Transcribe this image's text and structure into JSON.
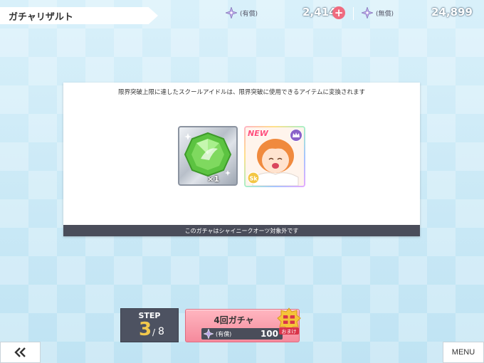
{
  "header": {
    "title": "ガチャリザルト",
    "paid_stars": {
      "label": "(有償)",
      "value": "2,414",
      "icon": "star-gem-icon"
    },
    "plus_label": "+",
    "free_stars": {
      "label": "(無償)",
      "value": "24,899",
      "icon": "star-gem-icon"
    }
  },
  "panel": {
    "message": "限界突破上限に達したスクールアイドルは、限界突破に使用できるアイテムに変換されます",
    "items": [
      {
        "type": "limit-break-gem",
        "quantity": "×1",
        "color": "#5cc341"
      },
      {
        "type": "idol-card",
        "badge": "NEW",
        "rarity_icon": "crown-icon",
        "attribute": "Sk"
      }
    ],
    "footer": "このガチャはシャイニークオーツ対象外です"
  },
  "step": {
    "label": "STEP",
    "current": "3",
    "sep": "/",
    "total": "8"
  },
  "gacha_button": {
    "title": "4回ガチャ",
    "cost_label": "(有償)",
    "cost_value": "100",
    "bonus_label": "おまけ"
  },
  "nav": {
    "back_icon": "double-chevron-left-icon",
    "menu_label": "MENU"
  },
  "colors": {
    "accent_pink": "#f58a9c",
    "step_gold": "#f2c94c",
    "dark_bar": "#4a4d5a"
  }
}
